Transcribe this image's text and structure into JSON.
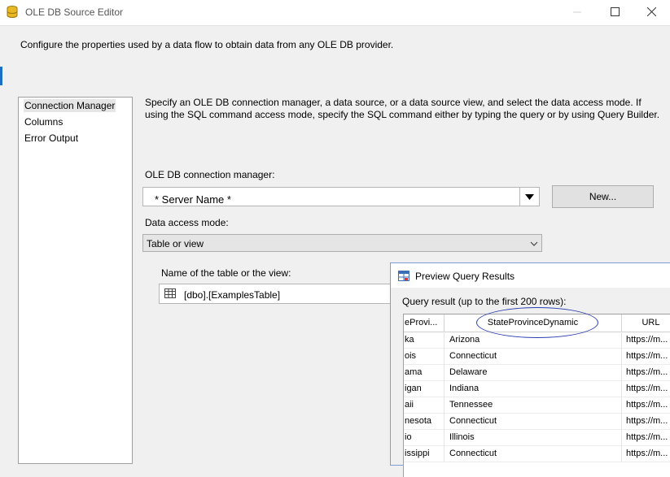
{
  "window": {
    "title": "OLE DB Source Editor",
    "description": "Configure the properties used by a data flow to obtain data from any OLE DB provider."
  },
  "nav": {
    "items": [
      {
        "label": "Connection Manager",
        "selected": true
      },
      {
        "label": "Columns",
        "selected": false
      },
      {
        "label": "Error Output",
        "selected": false
      }
    ]
  },
  "main": {
    "instructions": "Specify an OLE DB connection manager, a data source, or a data source view, and select the data access mode. If using the SQL command access mode, specify the SQL command either by typing the query or by using Query Builder.",
    "connection_label": "OLE DB connection manager:",
    "connection_value": "* Server Name *",
    "new_button": "New...",
    "access_mode_label": "Data access mode:",
    "access_mode_value": "Table or view",
    "table_label": "Name of the table or the view:",
    "table_value": "[dbo].[ExamplesTable]"
  },
  "preview": {
    "title": "Preview Query Results",
    "query_label": "Query result (up to the first 200 rows):",
    "columns": [
      "eProvi...",
      "StateProvinceDynamic",
      "URL"
    ],
    "rows": [
      [
        "ka",
        "Arizona",
        "https://m..."
      ],
      [
        "ois",
        "Connecticut",
        "https://m..."
      ],
      [
        "ama",
        "Delaware",
        "https://m..."
      ],
      [
        "igan",
        "Indiana",
        "https://m..."
      ],
      [
        "aii",
        "Tennessee",
        "https://m..."
      ],
      [
        "nesota",
        "Connecticut",
        "https://m..."
      ],
      [
        "io",
        "Illinois",
        "https://m..."
      ],
      [
        "issippi",
        "Connecticut",
        "https://m..."
      ]
    ]
  },
  "colors": {
    "accent": "#1c6fc7",
    "highlight_ellipse": "#2a3eb1"
  }
}
